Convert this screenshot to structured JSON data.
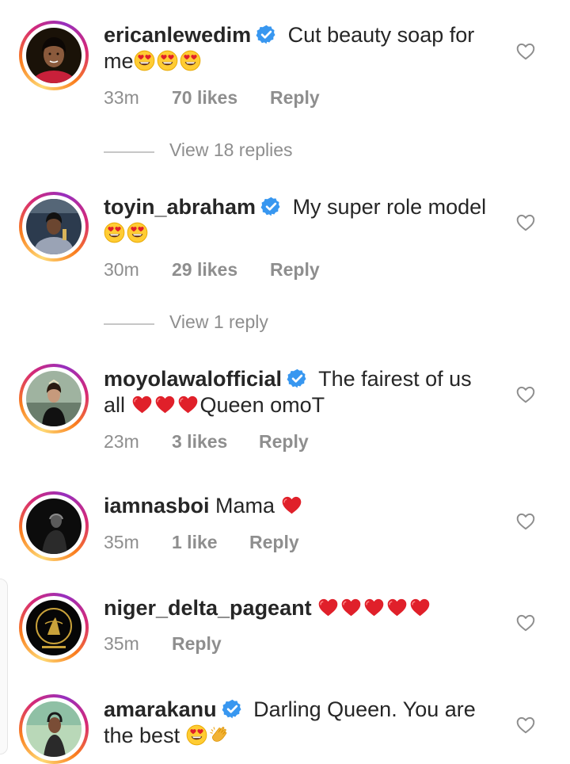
{
  "comments": [
    {
      "username": "ericanlewedim",
      "verified": true,
      "text": " Cut beauty soap for me",
      "emojis": [
        "heart-eyes",
        "heart-eyes",
        "heart-eyes"
      ],
      "time": "33m",
      "likes": "70 likes",
      "reply": "Reply",
      "view_replies": "View 18 replies"
    },
    {
      "username": "toyin_abraham",
      "verified": true,
      "text": " My super role model",
      "emojis": [
        "heart-eyes",
        "heart-eyes"
      ],
      "time": "30m",
      "likes": "29 likes",
      "reply": "Reply",
      "view_replies": "View 1 reply"
    },
    {
      "username": "moyolawalofficial",
      "verified": true,
      "text_before": " The fairest of us all ",
      "emojis": [
        "red-heart",
        "red-heart",
        "red-heart"
      ],
      "text_after": "Queen omoT",
      "time": "23m",
      "likes": "3 likes",
      "reply": "Reply"
    },
    {
      "username": "iamnasboi",
      "verified": false,
      "text": " Mama ",
      "emojis": [
        "red-heart"
      ],
      "time": "35m",
      "likes": "1 like",
      "reply": "Reply"
    },
    {
      "username": "niger_delta_pageant",
      "verified": false,
      "text": " ",
      "emojis": [
        "red-heart",
        "red-heart",
        "red-heart",
        "red-heart",
        "red-heart"
      ],
      "time": "35m",
      "reply": "Reply"
    },
    {
      "username": "amarakanu",
      "verified": true,
      "text": " Darling Queen. You are the best ",
      "emojis": [
        "heart-eyes",
        "clapping-hands"
      ]
    }
  ],
  "colors": {
    "text": "#262626",
    "secondary": "#8e8e8e",
    "verified_blue": "#3897f0",
    "heart_red": "#e0202a"
  }
}
